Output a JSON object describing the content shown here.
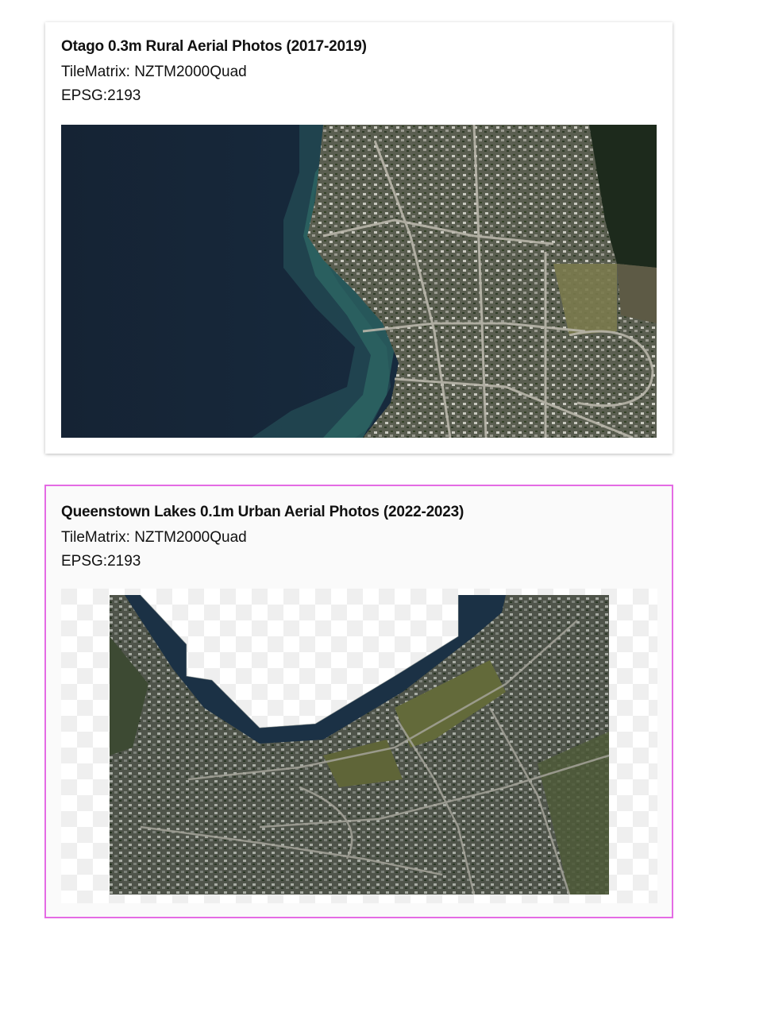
{
  "cards": [
    {
      "title": "Otago 0.3m Rural Aerial Photos (2017-2019)",
      "tile_matrix": "TileMatrix: NZTM2000Quad",
      "epsg": "EPSG:2193",
      "selected": false
    },
    {
      "title": "Queenstown Lakes 0.1m Urban Aerial Photos (2022-2023)",
      "tile_matrix": "TileMatrix: NZTM2000Quad",
      "epsg": "EPSG:2193",
      "selected": true
    }
  ],
  "colors": {
    "selected_border": "#e46be4",
    "lake_deep": "#17283c",
    "lake_shallow": "#2f6b66",
    "urban": "#55594f",
    "grass": "#6b7040",
    "forest": "#1d2a1c",
    "checker_light": "#ffffff",
    "checker_dark": "#efefef"
  }
}
